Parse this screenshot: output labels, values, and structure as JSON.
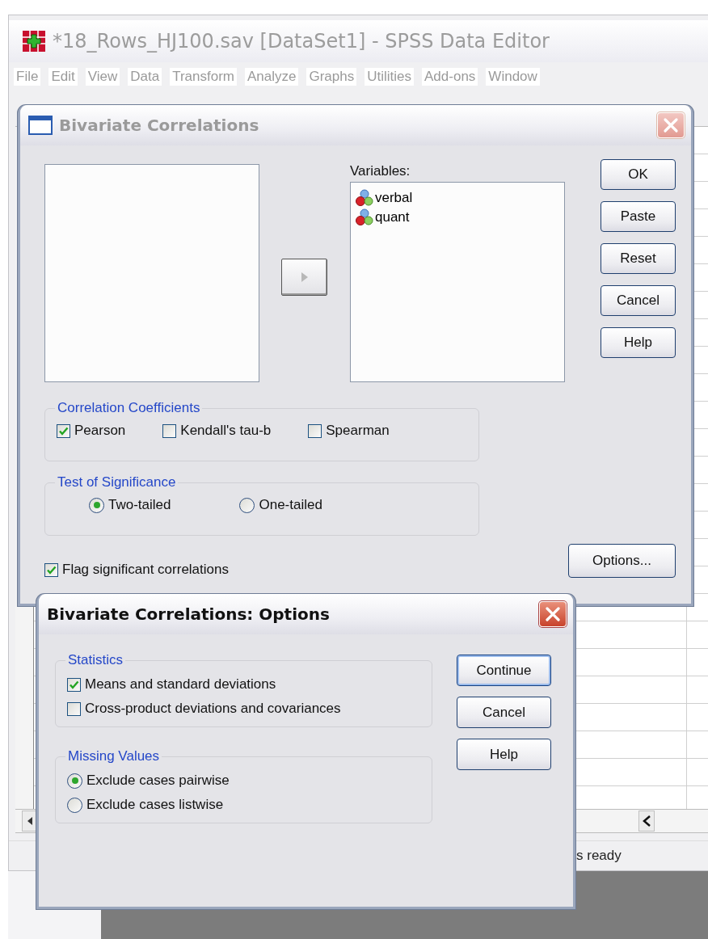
{
  "editor": {
    "title": "*18_Rows_HJ100.sav [DataSet1] - SPSS Data Editor",
    "menu": [
      "File",
      "Edit",
      "View",
      "Data",
      "Transform",
      "Analyze",
      "Graphs",
      "Utilities",
      "Add-ons",
      "Window"
    ],
    "status_text": "s ready"
  },
  "correlations_dialog": {
    "title": "Bivariate Correlations",
    "active": false,
    "variables_label": "Variables:",
    "variables": [
      {
        "name": "verbal"
      },
      {
        "name": "quant"
      }
    ],
    "transfer_button": {
      "disabled": true
    },
    "buttons": [
      {
        "label": "OK",
        "default": false
      },
      {
        "label": "Paste",
        "default": false
      },
      {
        "label": "Reset",
        "default": false
      },
      {
        "label": "Cancel",
        "default": false
      },
      {
        "label": "Help",
        "default": false
      }
    ],
    "coefficients": {
      "label": "Correlation Coefficients",
      "options": [
        {
          "label": "Pearson",
          "checked": true
        },
        {
          "label": "Kendall's tau-b",
          "checked": false
        },
        {
          "label": "Spearman",
          "checked": false
        }
      ]
    },
    "significance": {
      "label": "Test of Significance",
      "options": [
        {
          "label": "Two-tailed",
          "selected": true
        },
        {
          "label": "One-tailed",
          "selected": false
        }
      ]
    },
    "flag": {
      "label": "Flag significant correlations",
      "checked": true
    },
    "options_button": {
      "label": "Options...",
      "default": false
    }
  },
  "options_dialog": {
    "title": "Bivariate Correlations: Options",
    "active": true,
    "statistics": {
      "label": "Statistics",
      "options": [
        {
          "label": "Means and standard deviations",
          "checked": true
        },
        {
          "label": "Cross-product deviations and covariances",
          "checked": false
        }
      ]
    },
    "missing_values": {
      "label": "Missing Values",
      "options": [
        {
          "label": "Exclude cases pairwise",
          "selected": true
        },
        {
          "label": "Exclude cases listwise",
          "selected": false
        }
      ]
    },
    "buttons": [
      {
        "label": "Continue",
        "default": true
      },
      {
        "label": "Cancel",
        "default": false
      },
      {
        "label": "Help",
        "default": false
      }
    ]
  }
}
